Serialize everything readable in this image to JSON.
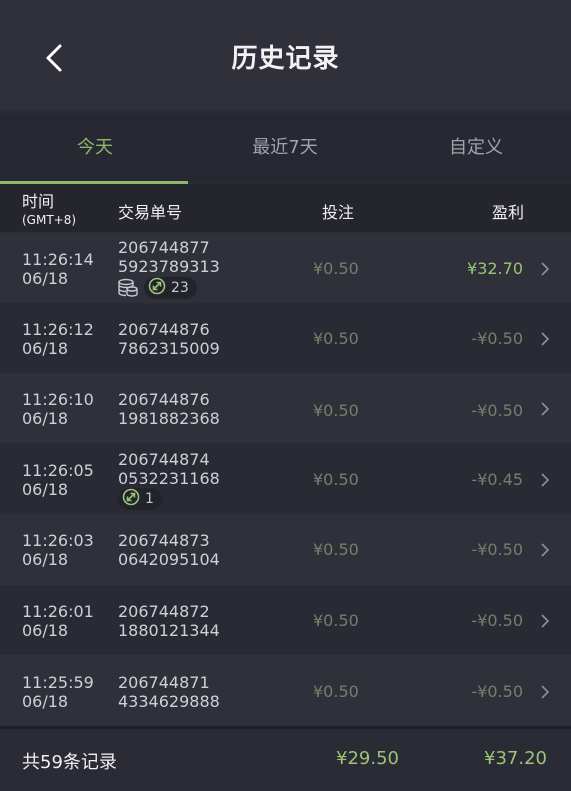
{
  "header": {
    "title": "历史记录",
    "back_icon": "chevron-left-icon"
  },
  "tabs": [
    {
      "label": "今天",
      "active": true
    },
    {
      "label": "最近7天",
      "active": false
    },
    {
      "label": "自定义",
      "active": false
    }
  ],
  "columns": {
    "time": "时间",
    "time_zone": "(GMT+8)",
    "order": "交易单号",
    "bet": "投注",
    "profit": "盈利"
  },
  "rows": [
    {
      "time": "11:26:14",
      "date": "06/18",
      "order_line1": "206744877",
      "order_line2": "5923789313",
      "bet": "¥0.50",
      "profit": "¥32.70",
      "has_coin_icon": true,
      "combo": "23"
    },
    {
      "time": "11:26:12",
      "date": "06/18",
      "order_line1": "206744876",
      "order_line2": "7862315009",
      "bet": "¥0.50",
      "profit": "-¥0.50"
    },
    {
      "time": "11:26:10",
      "date": "06/18",
      "order_line1": "206744876",
      "order_line2": "1981882368",
      "bet": "¥0.50",
      "profit": "-¥0.50"
    },
    {
      "time": "11:26:05",
      "date": "06/18",
      "order_line1": "206744874",
      "order_line2": "0532231168",
      "bet": "¥0.50",
      "profit": "-¥0.45",
      "combo": "1"
    },
    {
      "time": "11:26:03",
      "date": "06/18",
      "order_line1": "206744873",
      "order_line2": "0642095104",
      "bet": "¥0.50",
      "profit": "-¥0.50"
    },
    {
      "time": "11:26:01",
      "date": "06/18",
      "order_line1": "206744872",
      "order_line2": "1880121344",
      "bet": "¥0.50",
      "profit": "-¥0.50"
    },
    {
      "time": "11:25:59",
      "date": "06/18",
      "order_line1": "206744871",
      "order_line2": "4334629888",
      "bet": "¥0.50",
      "profit": "-¥0.50"
    }
  ],
  "footer": {
    "count_label": "共59条记录",
    "total_bet": "¥29.50",
    "total_profit": "¥37.20"
  },
  "colors": {
    "accent_green": "#8db66b",
    "profit_positive": "#9bc476",
    "muted_value": "#767e6c",
    "background": "#2b2c36"
  }
}
